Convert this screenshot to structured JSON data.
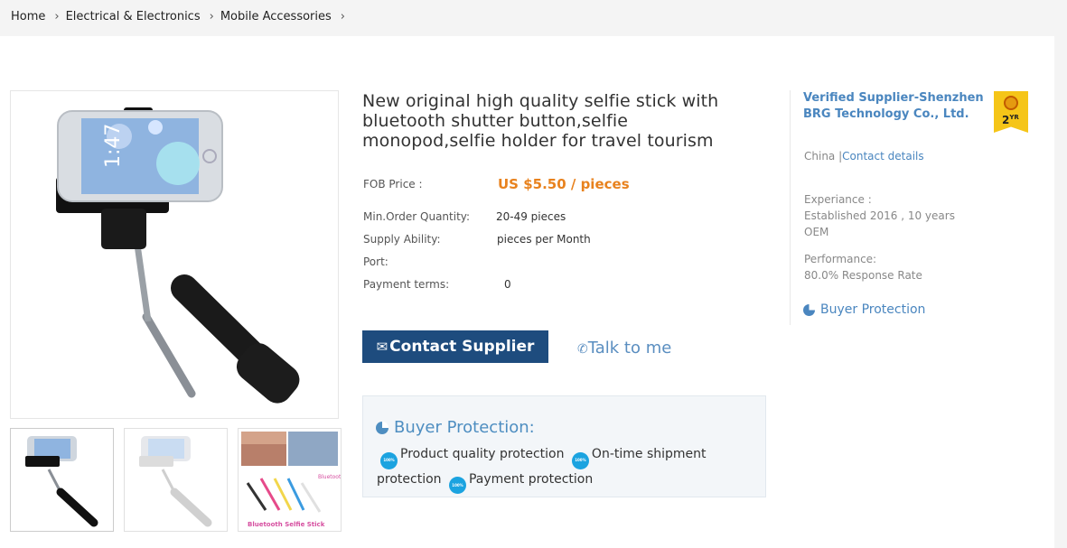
{
  "breadcrumb": {
    "items": [
      "Home",
      "Electrical & Electronics",
      "Mobile Accessories"
    ],
    "separator": ">"
  },
  "product": {
    "title": "New original high quality selfie stick with bluetooth shutter button,selfie monopod,selfie holder for travel tourism",
    "thumbnails": [
      "thumbnail-selfie-stick-black",
      "thumbnail-selfie-stick-white",
      "thumbnail-bluetooth-selfie-stick-colors"
    ],
    "thumb3_caption": "Bluetooth Selfie Stick"
  },
  "specs": {
    "fob_label": "FOB Price :",
    "fob_value": "US $5.50 / pieces",
    "moq_label": "Min.Order Quantity:",
    "moq_value": "20-49 pieces",
    "supply_label": "Supply Ability:",
    "supply_value": "pieces per Month",
    "port_label": "Port:",
    "port_value": "",
    "payment_label": "Payment terms:",
    "payment_value": "0"
  },
  "actions": {
    "contact_label": "Contact Supplier",
    "talk_label": "Talk to me"
  },
  "buyer_protection": {
    "title": "Buyer Protection:",
    "badge_text": "100%",
    "items": [
      "Product quality protection",
      "On-time shipment protection",
      "Payment protection"
    ]
  },
  "supplier": {
    "name": "Verified Supplier-Shenzhen BRG Technology Co., Ltd.",
    "badge_years": "2",
    "badge_unit": "YR",
    "country": "China |",
    "contact_link": "Contact details",
    "experience_label": "Experiance :",
    "established": "Established 2016 , 10 years",
    "type": "OEM",
    "performance_label": "Performance:",
    "response_rate": "80.0% Response Rate",
    "buyer_protection_link": "Buyer Protection"
  },
  "colors": {
    "price": "#e8821e",
    "button": "#1e4c7e",
    "link": "#4a86bf",
    "badge": "#1ba3e0"
  }
}
